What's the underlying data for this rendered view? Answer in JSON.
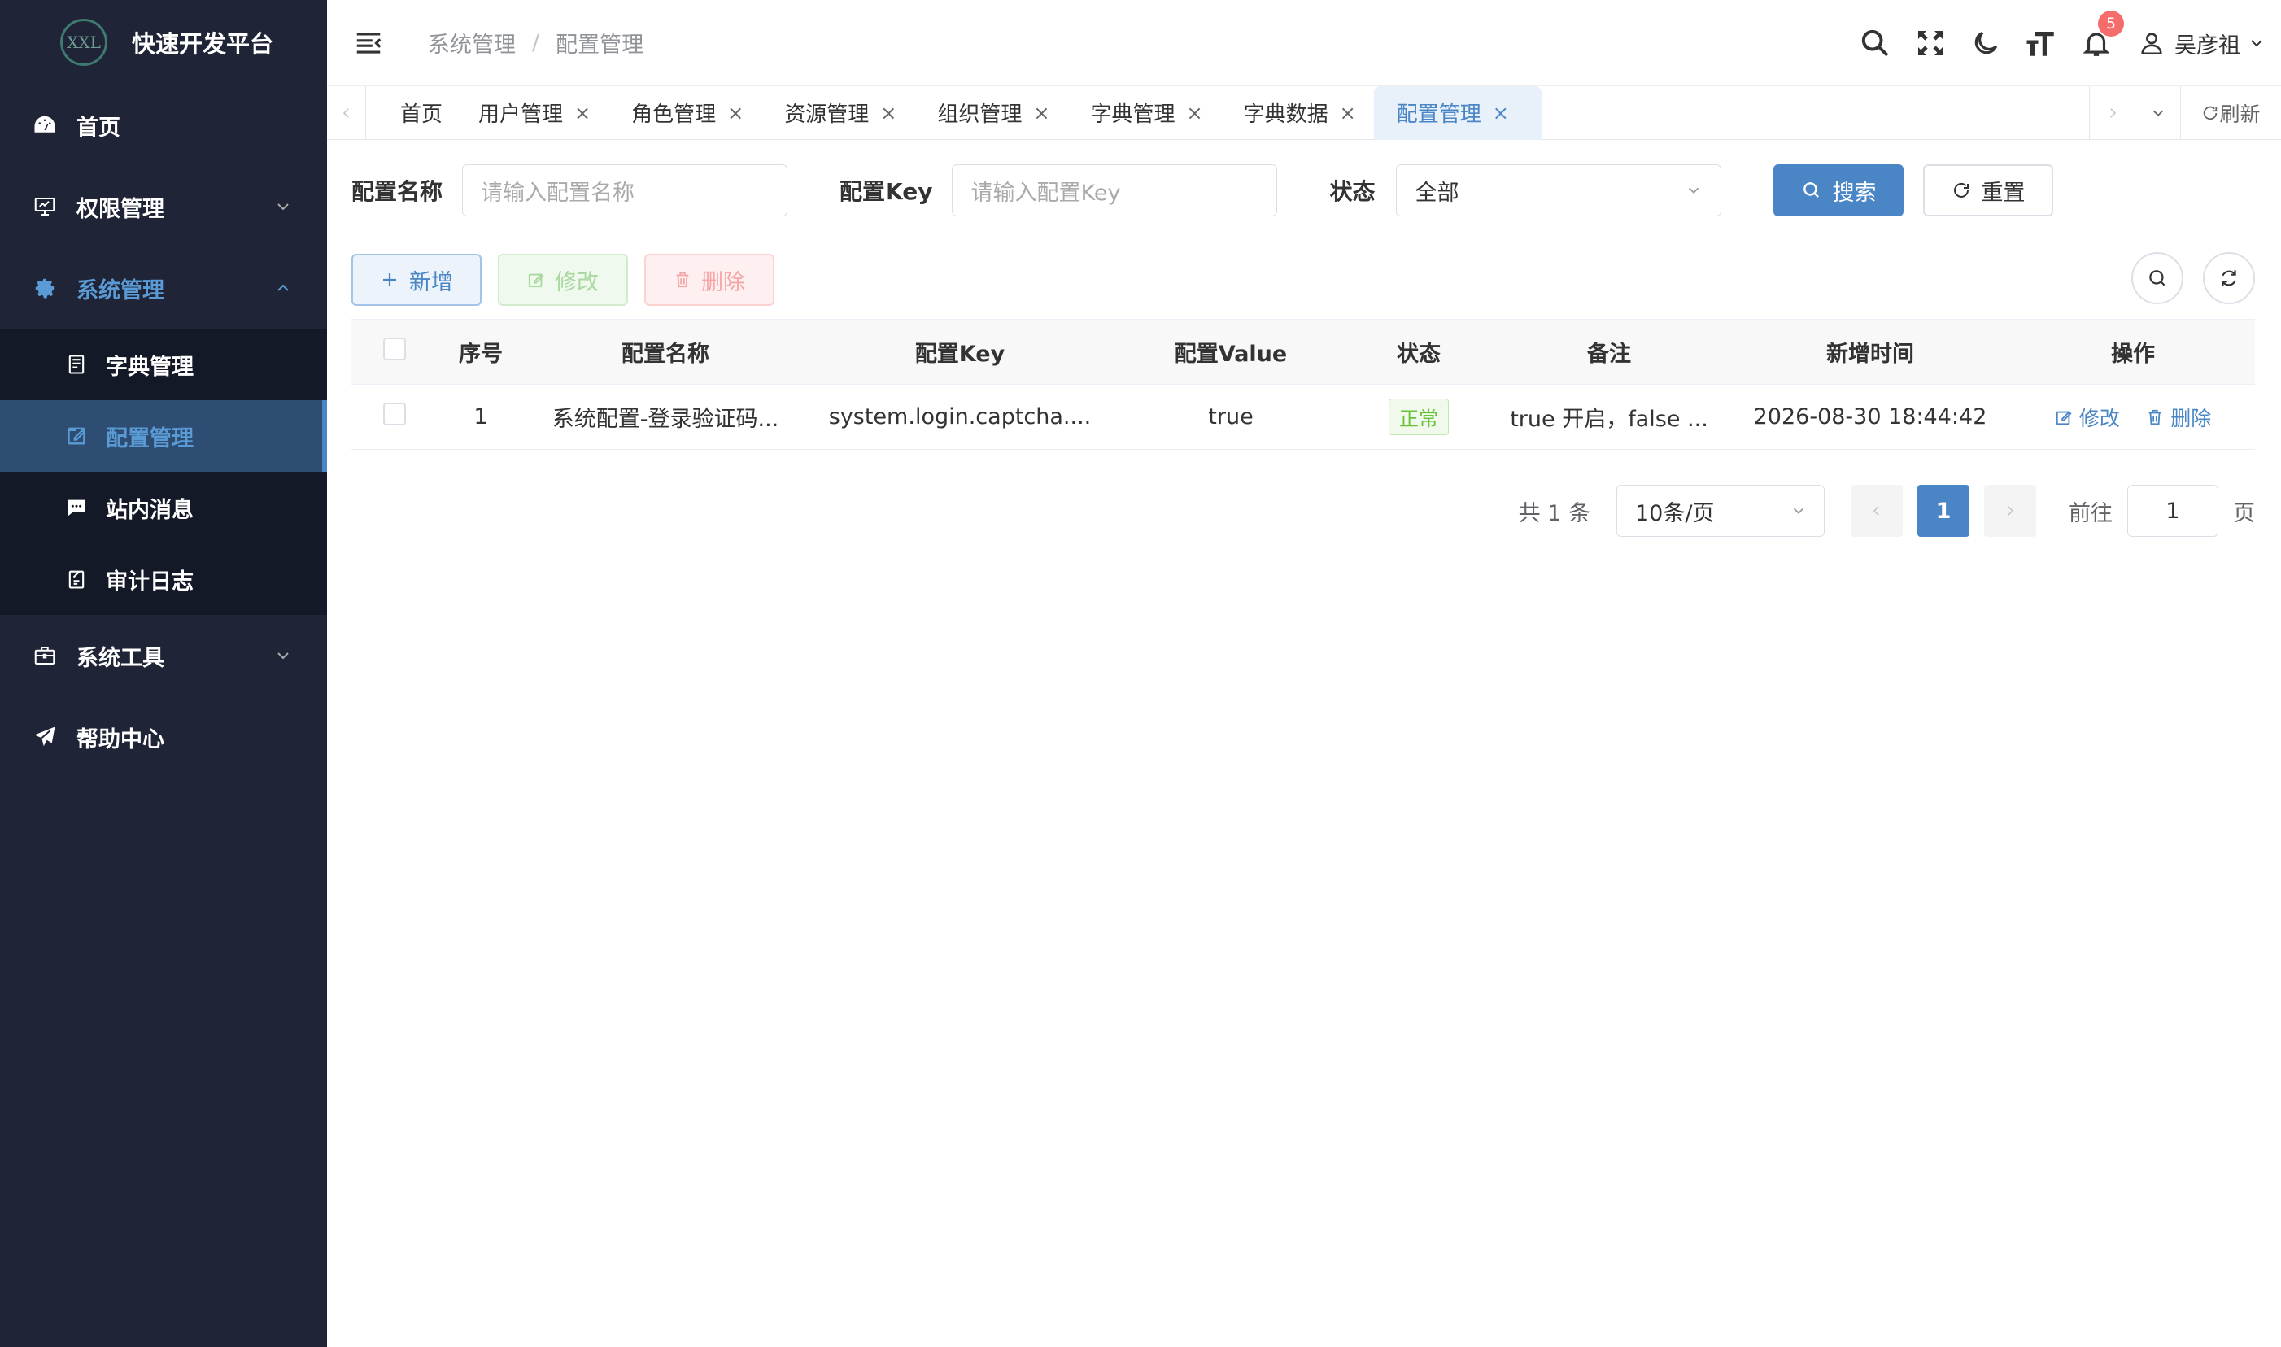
{
  "app": {
    "logo_text": "XXL",
    "title": "快速开发平台"
  },
  "sidebar": {
    "items": [
      {
        "label": "首页"
      },
      {
        "label": "权限管理"
      },
      {
        "label": "系统管理"
      },
      {
        "label": "系统工具"
      },
      {
        "label": "帮助中心"
      }
    ],
    "sub_items": [
      {
        "label": "字典管理"
      },
      {
        "label": "配置管理"
      },
      {
        "label": "站内消息"
      },
      {
        "label": "审计日志"
      }
    ]
  },
  "header": {
    "breadcrumb": [
      "系统管理",
      "配置管理"
    ],
    "breadcrumb_sep": "/",
    "notification_count": "5",
    "user_name": "吴彦祖"
  },
  "tabs": {
    "items": [
      "首页",
      "用户管理",
      "角色管理",
      "资源管理",
      "组织管理",
      "字典管理",
      "字典数据",
      "配置管理"
    ],
    "close": "×",
    "refresh_label": "刷新"
  },
  "search": {
    "name_label": "配置名称",
    "name_placeholder": "请输入配置名称",
    "key_label": "配置Key",
    "key_placeholder": "请输入配置Key",
    "status_label": "状态",
    "status_value": "全部",
    "search_button": "搜索",
    "reset_button": "重置"
  },
  "toolbar": {
    "add": "新增",
    "edit": "修改",
    "delete": "删除"
  },
  "table": {
    "columns": [
      "序号",
      "配置名称",
      "配置Key",
      "配置Value",
      "状态",
      "备注",
      "新增时间",
      "操作"
    ],
    "rows": [
      {
        "index": "1",
        "name": "系统配置-登录验证码...",
        "key": "system.login.captcha....",
        "value": "true",
        "status": "正常",
        "remark": "true 开启，false ...",
        "created": "2026-08-30 18:44:42",
        "edit": "修改",
        "delete": "删除"
      }
    ]
  },
  "pagination": {
    "total": "共 1 条",
    "page_size": "10条/页",
    "current": "1",
    "goto_label": "前往",
    "goto_value": "1",
    "page_suffix": "页"
  },
  "colors": {
    "accent": "#4a86c5",
    "sidebar_bg": "#1f2436",
    "success": "#67c23a",
    "danger": "#f56c6c"
  }
}
